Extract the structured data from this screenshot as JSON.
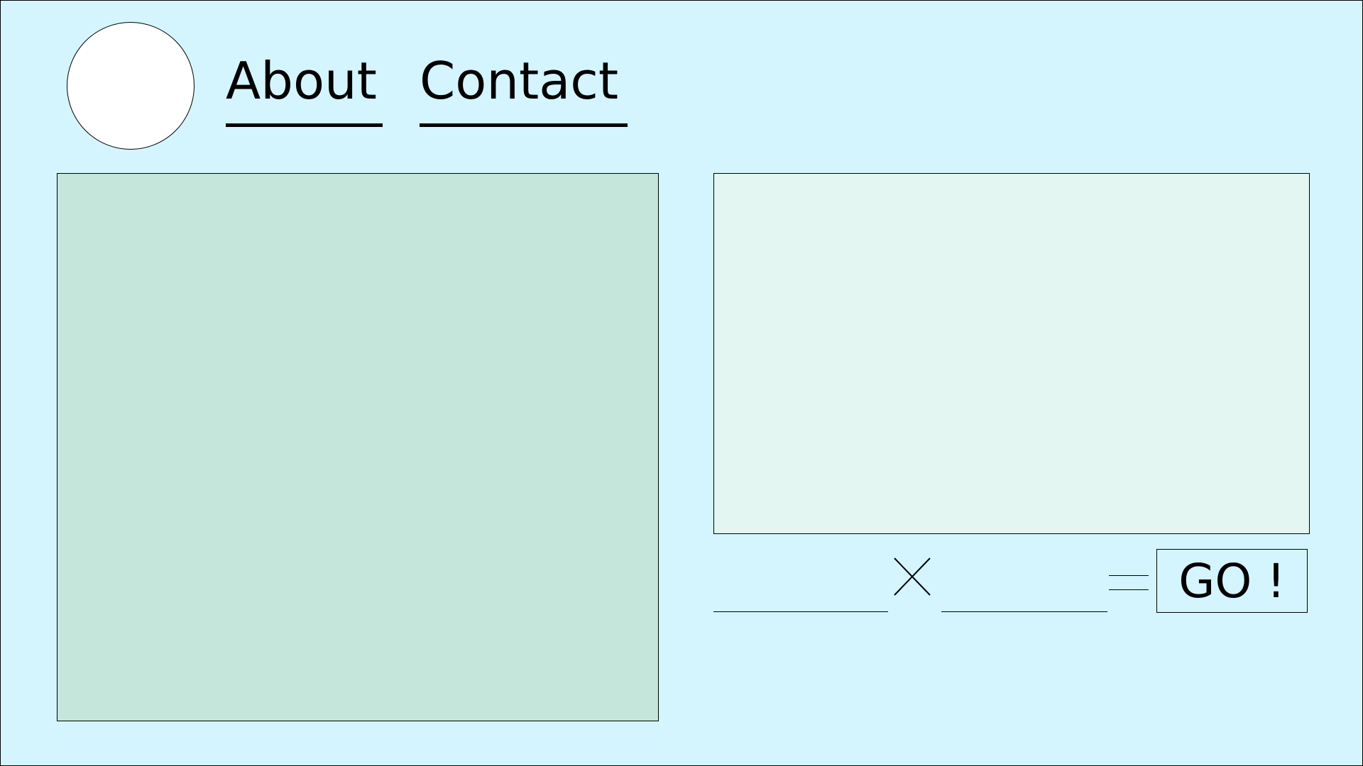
{
  "nav": {
    "items": [
      {
        "label": "About"
      },
      {
        "label": "Contact"
      }
    ]
  },
  "form": {
    "operand1_value": "",
    "operand2_value": "",
    "operator_icon": "times-icon",
    "equals_icon": "equals-icon",
    "go_label": "GO !"
  },
  "colors": {
    "background": "#d4f5fe",
    "left_panel": "#c5e6da",
    "right_panel": "#e4f6f1",
    "logo": "#ffffff"
  }
}
